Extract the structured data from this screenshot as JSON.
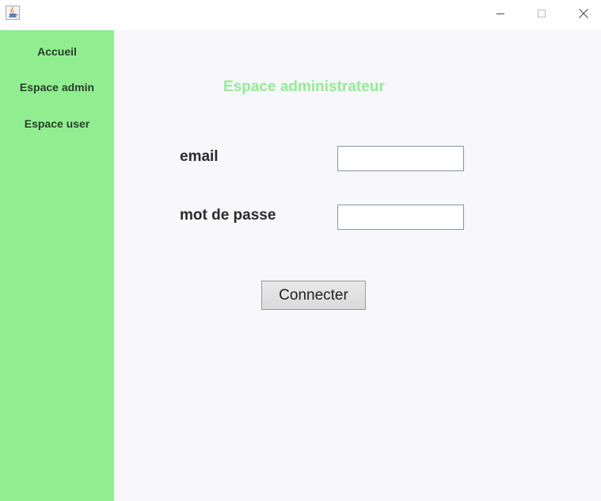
{
  "window": {
    "icon": "java-app-icon",
    "controls": [
      "minimize-icon",
      "maximize-icon",
      "close-icon"
    ]
  },
  "sidebar": {
    "background_color": "#90ee90",
    "items": [
      {
        "label": "Accueil"
      },
      {
        "label": "Espace admin"
      },
      {
        "label": "Espace user"
      }
    ]
  },
  "main": {
    "title": "Espace administrateur",
    "title_color": "#90ee90",
    "email_label": "email",
    "password_label": "mot de passe",
    "email_value": "",
    "password_value": "",
    "connect_button": "Connecter"
  }
}
